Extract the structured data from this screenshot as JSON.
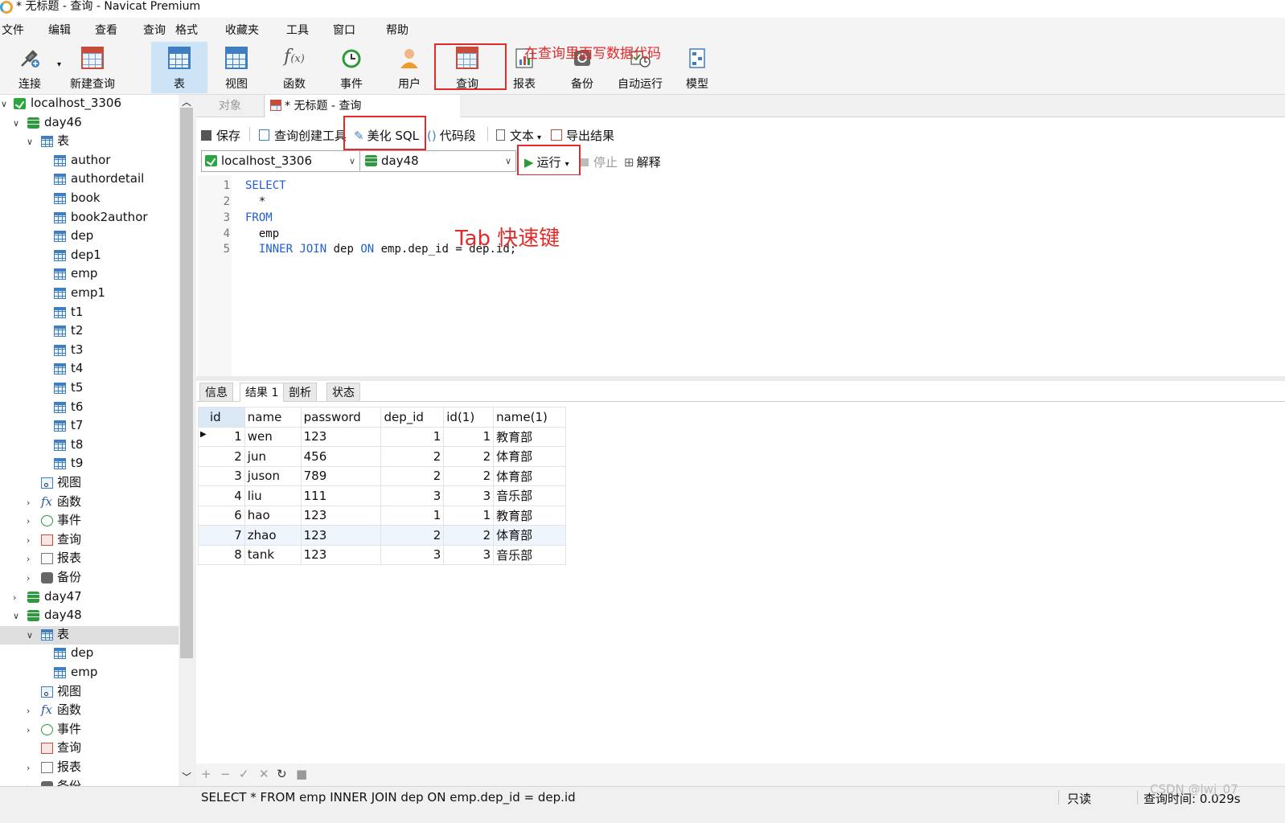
{
  "window": {
    "title": "* 无标题 - 查询 - Navicat Premium"
  },
  "menu": [
    "文件",
    "编辑",
    "查看",
    "查询",
    "格式",
    "收藏夹",
    "工具",
    "窗口",
    "帮助"
  ],
  "toolbar": {
    "connect": "连接",
    "new_query": "新建查询",
    "table": "表",
    "view": "视图",
    "function": "函数",
    "event": "事件",
    "user": "用户",
    "query": "查询",
    "report": "报表",
    "backup": "备份",
    "autorun": "自动运行",
    "model": "模型"
  },
  "annotations": {
    "query_note": "在查询里面写数据代码",
    "tab_note": "Tab 快速键"
  },
  "sidebar": {
    "connection": "localhost_3306",
    "day46": "day46",
    "tables_label": "表",
    "day46_tables": [
      "author",
      "authordetail",
      "book",
      "book2author",
      "dep",
      "dep1",
      "emp",
      "emp1",
      "t1",
      "t2",
      "t3",
      "t4",
      "t5",
      "t6",
      "t7",
      "t8",
      "t9"
    ],
    "views_label": "视图",
    "functions_label": "函数",
    "events_label": "事件",
    "queries_label": "查询",
    "reports_label": "报表",
    "backups_label": "备份",
    "day47": "day47",
    "day48": "day48",
    "day48_tables": [
      "dep",
      "emp"
    ],
    "cutoff_label": "备份"
  },
  "tabs": {
    "objects": "对象",
    "query_tab": "* 无标题 - 查询"
  },
  "query_toolbar": {
    "save": "保存",
    "builder": "查询创建工具",
    "beautify": "美化 SQL",
    "snippet": "代码段",
    "text": "文本",
    "export": "导出结果"
  },
  "selectors": {
    "connection": "localhost_3306",
    "database": "day48"
  },
  "run": {
    "run": "运行",
    "stop": "停止",
    "explain": "解释"
  },
  "editor": {
    "line_numbers": [
      "1",
      "2",
      "3",
      "4",
      "5"
    ],
    "l1": "SELECT",
    "l2": "  *",
    "l3": "FROM",
    "l4": "  emp",
    "l5a": "  INNER JOIN",
    "l5b": " dep ",
    "l5c": "ON",
    "l5d": " emp.dep_id = dep.id;"
  },
  "result_tabs": [
    "信息",
    "结果 1",
    "剖析",
    "状态"
  ],
  "result": {
    "columns": [
      "id",
      "name",
      "password",
      "dep_id",
      "id(1)",
      "name(1)"
    ],
    "rows": [
      [
        "1",
        "wen",
        "123",
        "1",
        "1",
        "教育部"
      ],
      [
        "2",
        "jun",
        "456",
        "2",
        "2",
        "体育部"
      ],
      [
        "3",
        "juson",
        "789",
        "2",
        "2",
        "体育部"
      ],
      [
        "4",
        "liu",
        "111",
        "3",
        "3",
        "音乐部"
      ],
      [
        "6",
        "hao",
        "123",
        "1",
        "1",
        "教育部"
      ],
      [
        "7",
        "zhao",
        "123",
        "2",
        "2",
        "体育部"
      ],
      [
        "8",
        "tank",
        "123",
        "3",
        "3",
        "音乐部"
      ]
    ]
  },
  "nav_buttons": [
    "+",
    "−",
    "✓",
    "✕",
    "↻",
    "■"
  ],
  "status": {
    "sql": "SELECT * FROM emp INNER JOIN dep ON emp.dep_id = dep.id",
    "readonly": "只读",
    "time": "查询时间: 0.029s",
    "watermark": "CSDN @lwj_07"
  },
  "colors": {
    "accent_red": "#e12b2b",
    "selection": "#cde4f7",
    "keyword": "#1f5fd0"
  }
}
